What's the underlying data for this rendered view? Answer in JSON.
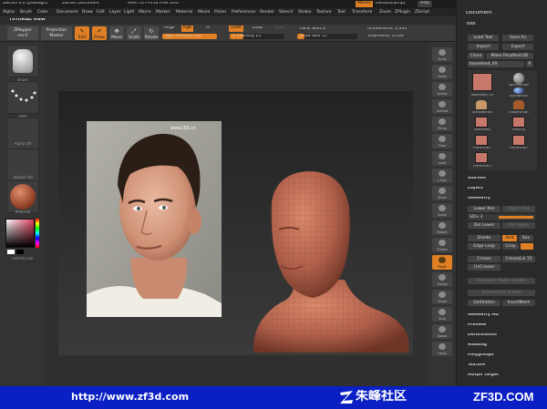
{
  "titlebar": {
    "app": "ZBrush",
    "items": [
      "ZBrush 4.0 [pixologic]",
      "ZBrush Document",
      "Mem 517+218 Free 2047"
    ],
    "right_buttons": [
      "Menus",
      "DefaultZScript",
      "Help"
    ]
  },
  "menubar": [
    "Alpha",
    "Brush",
    "Color",
    "Document",
    "Draw",
    "Edit",
    "Layer",
    "Light",
    "Macro",
    "Marker",
    "Material",
    "Movie",
    "Picker",
    "Preferences",
    "Render",
    "Stencil",
    "Stroke",
    "Texture",
    "Tool",
    "Transform",
    "Zoom",
    "ZPlugin",
    "ZScript"
  ],
  "tutorial_label": "TUTORIAL VIEW",
  "toolbar": {
    "zmapper": "ZMapper",
    "zmapper_sub": "rev-E",
    "projection_master": "Projection",
    "projection_master_sub": "Master",
    "edit": "Edit",
    "draw": "Draw",
    "move": "Move",
    "scale": "Scale",
    "rotate": "Rotate",
    "mrgb": "Mrgb",
    "rgb": "Rgb",
    "m": "M",
    "zadd": "Zadd",
    "zsub": "Zsub",
    "zcut": "Zcut",
    "rgb_intensity": "Rgb Intensity 100",
    "z_intensity": "Z Intensity 25",
    "focal_shift": "Focal Shift 0",
    "draw_size": "Draw Size 51",
    "active_points": "ActivePoints: 2,434",
    "total_points": "TotalPoints: 2,434"
  },
  "leftshelf": {
    "slots": [
      "Brush",
      "Dots",
      "Alpha Off",
      "Texture Off",
      "Material",
      ""
    ],
    "switch_color": "SwitchColor"
  },
  "rightshelf": [
    "Scroll",
    "Zoom",
    "Actual",
    "AAHalf",
    "Persp",
    "Floor",
    "Local",
    "L.Sym",
    "Move",
    "Scale",
    "Rotate",
    "Frame",
    "PolyF",
    "Transp",
    "Ghost",
    "Solo",
    "Xpose",
    "Lasso"
  ],
  "rightpanel": {
    "document": "Document",
    "tool": "Tool",
    "load_tool": "Load Tool",
    "save_as": "Save As",
    "import": "Import",
    "export": "Export",
    "clone": "Clone",
    "make_polymesh": "Make PolyMesh3D",
    "current_tool": "baseHead_49",
    "thumbs": [
      "baseHead_49",
      "SphereBrush",
      "AlphaBrush",
      "SimpleBrush",
      "EraserBrush",
      "baseHead",
      "Plane3D",
      "Plane3D#1",
      "Plane3D#2",
      "Plane3D#3"
    ],
    "subtool": "SubTool",
    "layers": "Layers",
    "geometry": "Geometry",
    "lower_res": "Lower Res",
    "higher_res": "Higher Res",
    "sdiv": "SDiv 3",
    "del_lower": "Del Lower",
    "del_higher": "Del Higher",
    "divide": "Divide",
    "smt": "Smt",
    "suv": "Suv",
    "edge_loop": "Edge Loop",
    "crisp": "Crisp",
    "crease": "Crease",
    "crease_lvl": "CreaseLvl 15",
    "uncrease": "UnCrease",
    "reproject": "Reproject Higher Subdiv",
    "reconstruct": "Reconstruct Subdiv",
    "delhidden": "DelHidden",
    "insertmesh": "InsertMesh",
    "geometry_hd": "Geometry HD",
    "preview": "Preview",
    "deformation": "Deformation",
    "masking": "Masking",
    "polygroups": "Polygroups",
    "texture": "Texture",
    "morph_target": "Morph Target"
  },
  "photo_watermark": "www.3D.cn",
  "footer": {
    "url": "http://www.zf3d.com",
    "community": "朱峰社区",
    "brand": "ZF3D.COM"
  },
  "colors": {
    "accent": "#e07f24",
    "footer": "#0a1fc4",
    "clay": "#b86a55"
  }
}
